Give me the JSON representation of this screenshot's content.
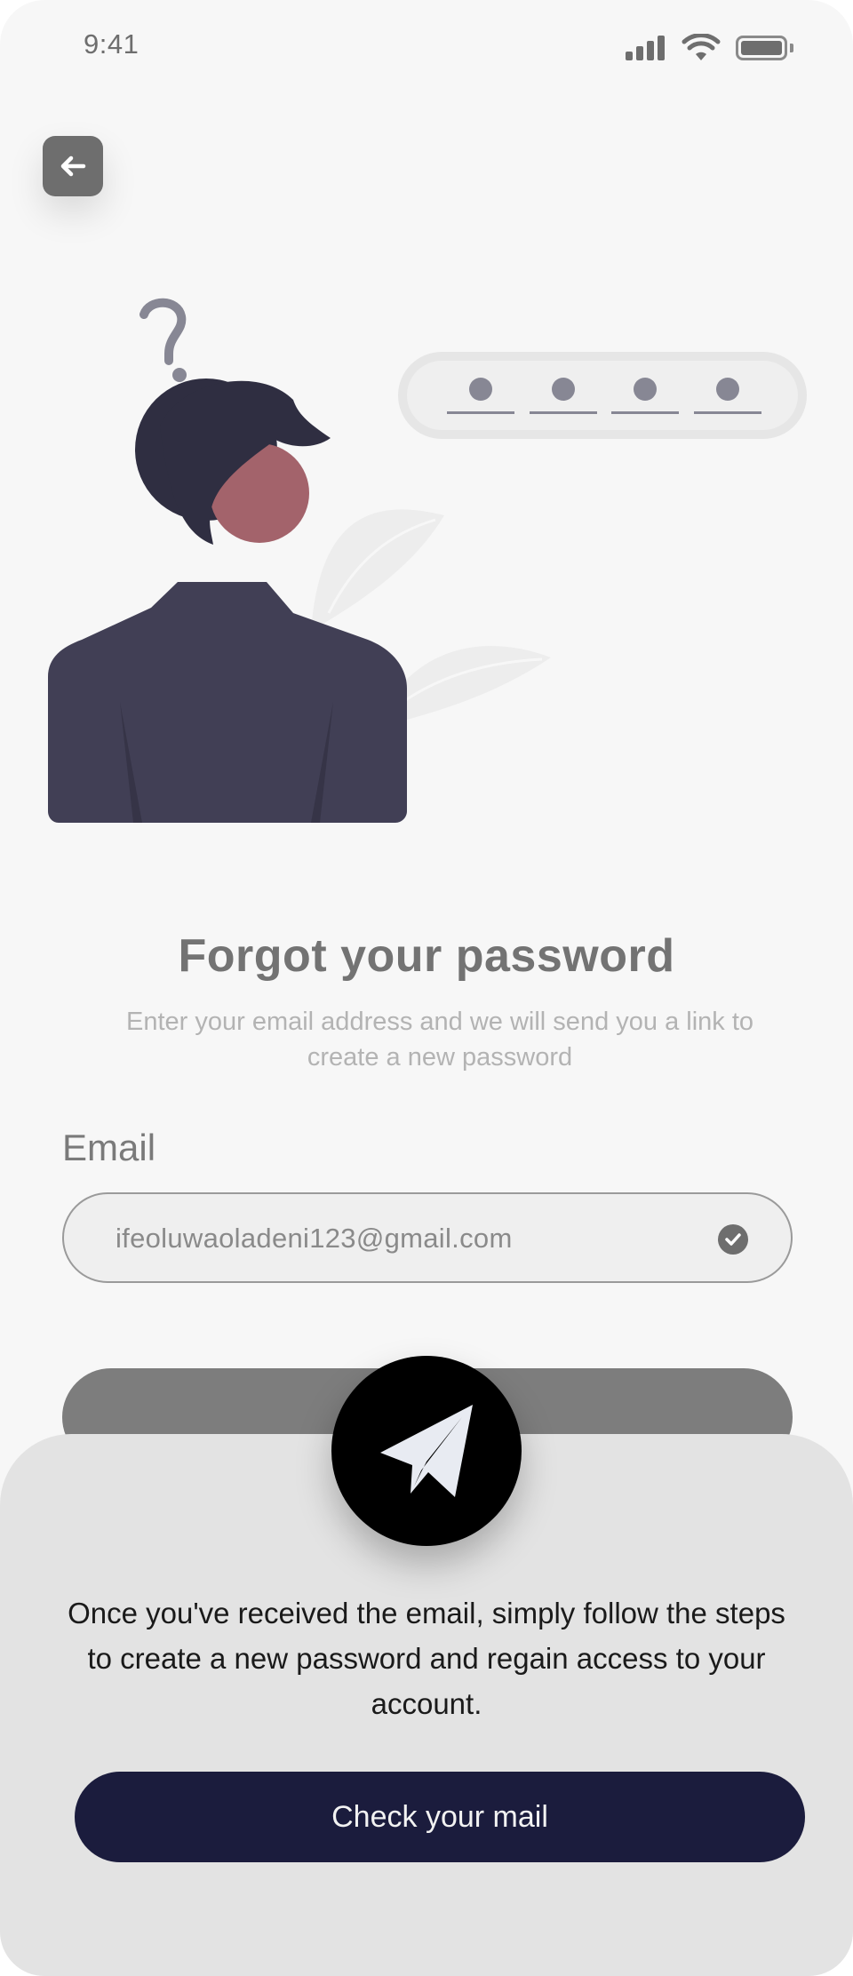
{
  "status_bar": {
    "time": "9:41"
  },
  "header": {
    "back_icon": "arrow-left-icon"
  },
  "illustration": {
    "pin_dots": 4,
    "question_mark": "?"
  },
  "main": {
    "title": "Forgot your password",
    "subtitle": "Enter your email address and we will send you a link to create a new password",
    "email_label": "Email",
    "email_value": "ifeoluwaoladeni123@gmail.com",
    "email_valid_icon": "check-circle-icon"
  },
  "sheet": {
    "icon": "paper-plane-icon",
    "message": "Once you've received the email, simply follow the steps to create a new password and regain access to your account.",
    "button_label": "Check your mail"
  },
  "colors": {
    "background": "#f7f7f7",
    "accent_dark": "#1b1c3d",
    "sheet": "#e3e3e3",
    "muted_text": "#737373"
  }
}
